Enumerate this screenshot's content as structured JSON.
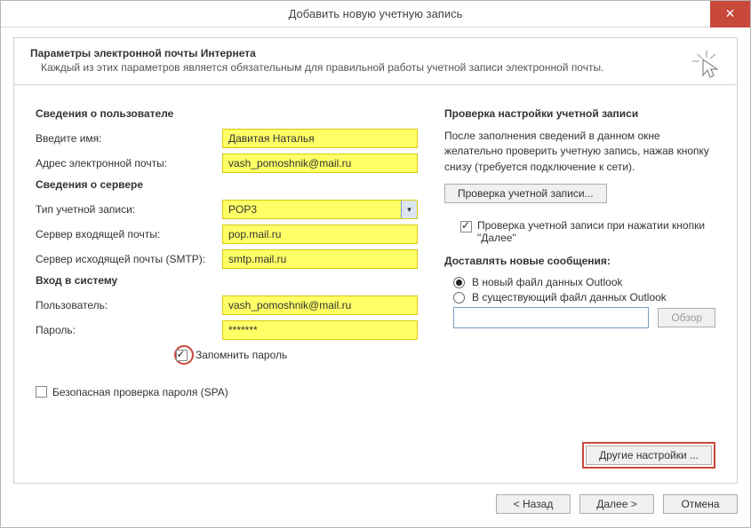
{
  "window": {
    "title": "Добавить новую учетную запись",
    "close": "✕"
  },
  "header": {
    "title": "Параметры электронной почты Интернета",
    "subtitle": "Каждый из этих параметров является обязательным для правильной работы учетной записи электронной почты."
  },
  "left": {
    "section_user": "Сведения о пользователе",
    "name_label": "Введите имя:",
    "name_value": "Давитая Наталья",
    "email_label": "Адрес электронной почты:",
    "email_value": "vash_pomoshnik@mail.ru",
    "section_server": "Сведения о сервере",
    "acct_type_label": "Тип учетной записи:",
    "acct_type_value": "POP3",
    "incoming_label": "Сервер входящей почты:",
    "incoming_value": "pop.mail.ru",
    "outgoing_label": "Сервер исходящей почты (SMTP):",
    "outgoing_value": "smtp.mail.ru",
    "section_login": "Вход в систему",
    "user_label": "Пользователь:",
    "user_value": "vash_pomoshnik@mail.ru",
    "pass_label": "Пароль:",
    "pass_value": "*******",
    "remember": "Запомнить пароль",
    "spa": "Безопасная проверка пароля (SPA)"
  },
  "right": {
    "section_test": "Проверка настройки учетной записи",
    "test_text": "После заполнения сведений в данном окне желательно проверить учетную запись, нажав кнопку снизу (требуется подключение к сети).",
    "test_btn": "Проверка учетной записи...",
    "test_on_next": "Проверка учетной записи при нажатии кнопки \"Далее\"",
    "deliver_title": "Доставлять новые сообщения:",
    "radio_new": "В новый файл данных Outlook",
    "radio_existing": "В существующий файл данных Outlook",
    "browse": "Обзор",
    "more": "Другие настройки ..."
  },
  "footer": {
    "back": "< Назад",
    "next": "Далее >",
    "cancel": "Отмена"
  }
}
